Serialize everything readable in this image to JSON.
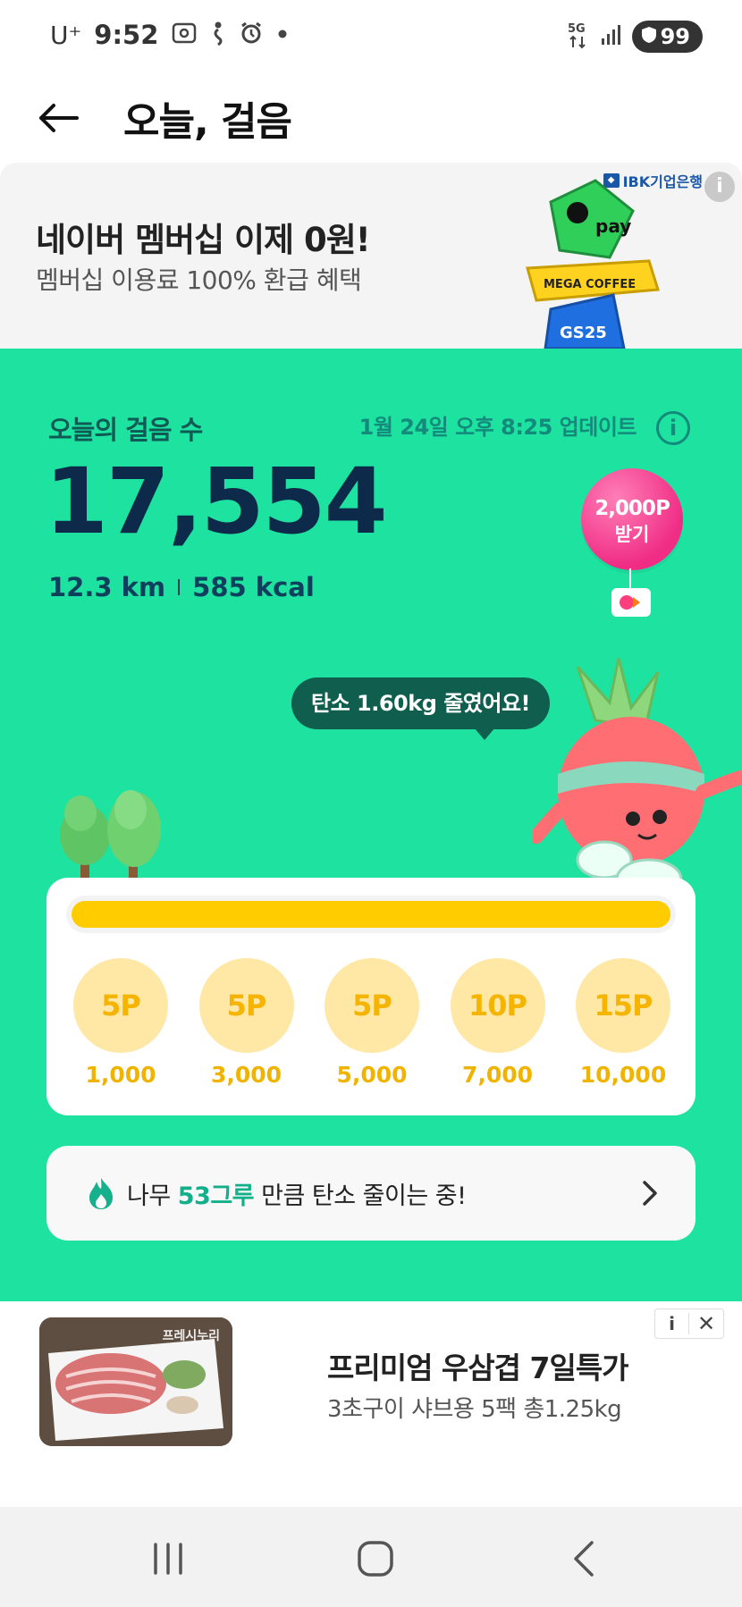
{
  "status_bar": {
    "carrier": "U⁺",
    "time": "9:52",
    "network": "5G",
    "battery": "99"
  },
  "header": {
    "title": "오늘, 걸음"
  },
  "banner": {
    "title": "네이버 멤버십 이제 0원!",
    "subtitle": "멤버십 이용료 100% 환급 혜택",
    "brand": "IBK기업은행",
    "info": "i"
  },
  "steps": {
    "label": "오늘의 걸음 수",
    "update": "1월 24일 오후 8:25 업데이트",
    "count": "17,554",
    "distance": "12.3 km",
    "calories": "585 kcal",
    "reward_amount": "2,000P",
    "reward_action": "받기",
    "carbon_message": "탄소 1.60kg 줄였어요!",
    "progress": 1.0
  },
  "milestones": [
    {
      "points": "5P",
      "steps": "1,000"
    },
    {
      "points": "5P",
      "steps": "3,000"
    },
    {
      "points": "5P",
      "steps": "5,000"
    },
    {
      "points": "10P",
      "steps": "7,000"
    },
    {
      "points": "15P",
      "steps": "10,000"
    }
  ],
  "tree_row": {
    "prefix": "나무 ",
    "count": "53그루",
    "suffix": " 만큼 탄소 줄이는 중!"
  },
  "ad": {
    "thumb_label": "프레시누리",
    "title": "프리미엄 우삼겹 7일특가",
    "subtitle": "3초구이 샤브용 5팩 총1.25kg",
    "info": "i",
    "close": "✕"
  },
  "colors": {
    "green": "#1ee3a0",
    "yellow": "#ffcc00",
    "pink": "#f02c85",
    "navy": "#0e2a4a"
  }
}
